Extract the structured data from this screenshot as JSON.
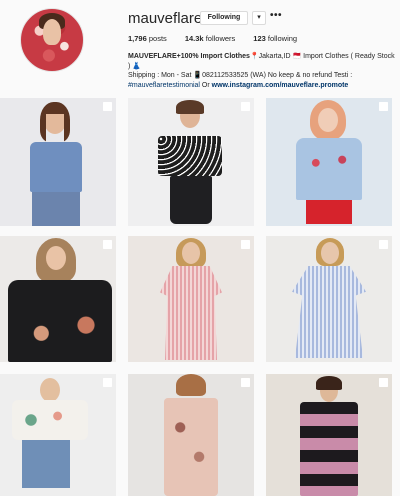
{
  "profile": {
    "username": "mauveflare",
    "follow_label": "Following",
    "dropdown_glyph": "▾",
    "more_glyph": "•••",
    "stats": {
      "posts_count": "1,796",
      "posts_label": "posts",
      "followers_count": "14.3k",
      "followers_label": "followers",
      "following_count": "123",
      "following_label": "following"
    },
    "bio": {
      "name": "MAUVEFLARE+100% Import Clothes",
      "line1_rest": "📍Jakarta,ID 🇲🇨 Import Clothes ( Ready Stock ) 👗",
      "line2": "Shipping : Mon - Sat 📱082112533525 (WA) No keep & no refund Testi :",
      "hashtag": "#mauveflaretestimonial",
      "or_text": " Or ",
      "link": "www.instagram.com/mauveflare.promote"
    }
  },
  "posts": [
    {
      "icon": "multi-photo-icon",
      "bg": "#e9e9ec"
    },
    {
      "icon": "multi-photo-icon",
      "bg": "#efeff0"
    },
    {
      "icon": "multi-photo-icon",
      "bg": "#dfe7ee"
    },
    {
      "icon": "multi-photo-icon",
      "bg": "#eceae8"
    },
    {
      "icon": "multi-photo-icon",
      "bg": "#ebe6e2"
    },
    {
      "icon": "multi-photo-icon",
      "bg": "#ecebe9"
    },
    {
      "icon": "multi-photo-icon",
      "bg": "#eeeeee"
    },
    {
      "icon": "multi-photo-icon",
      "bg": "#e6e4e2"
    },
    {
      "icon": "multi-photo-icon",
      "bg": "#e5e0d9"
    }
  ]
}
